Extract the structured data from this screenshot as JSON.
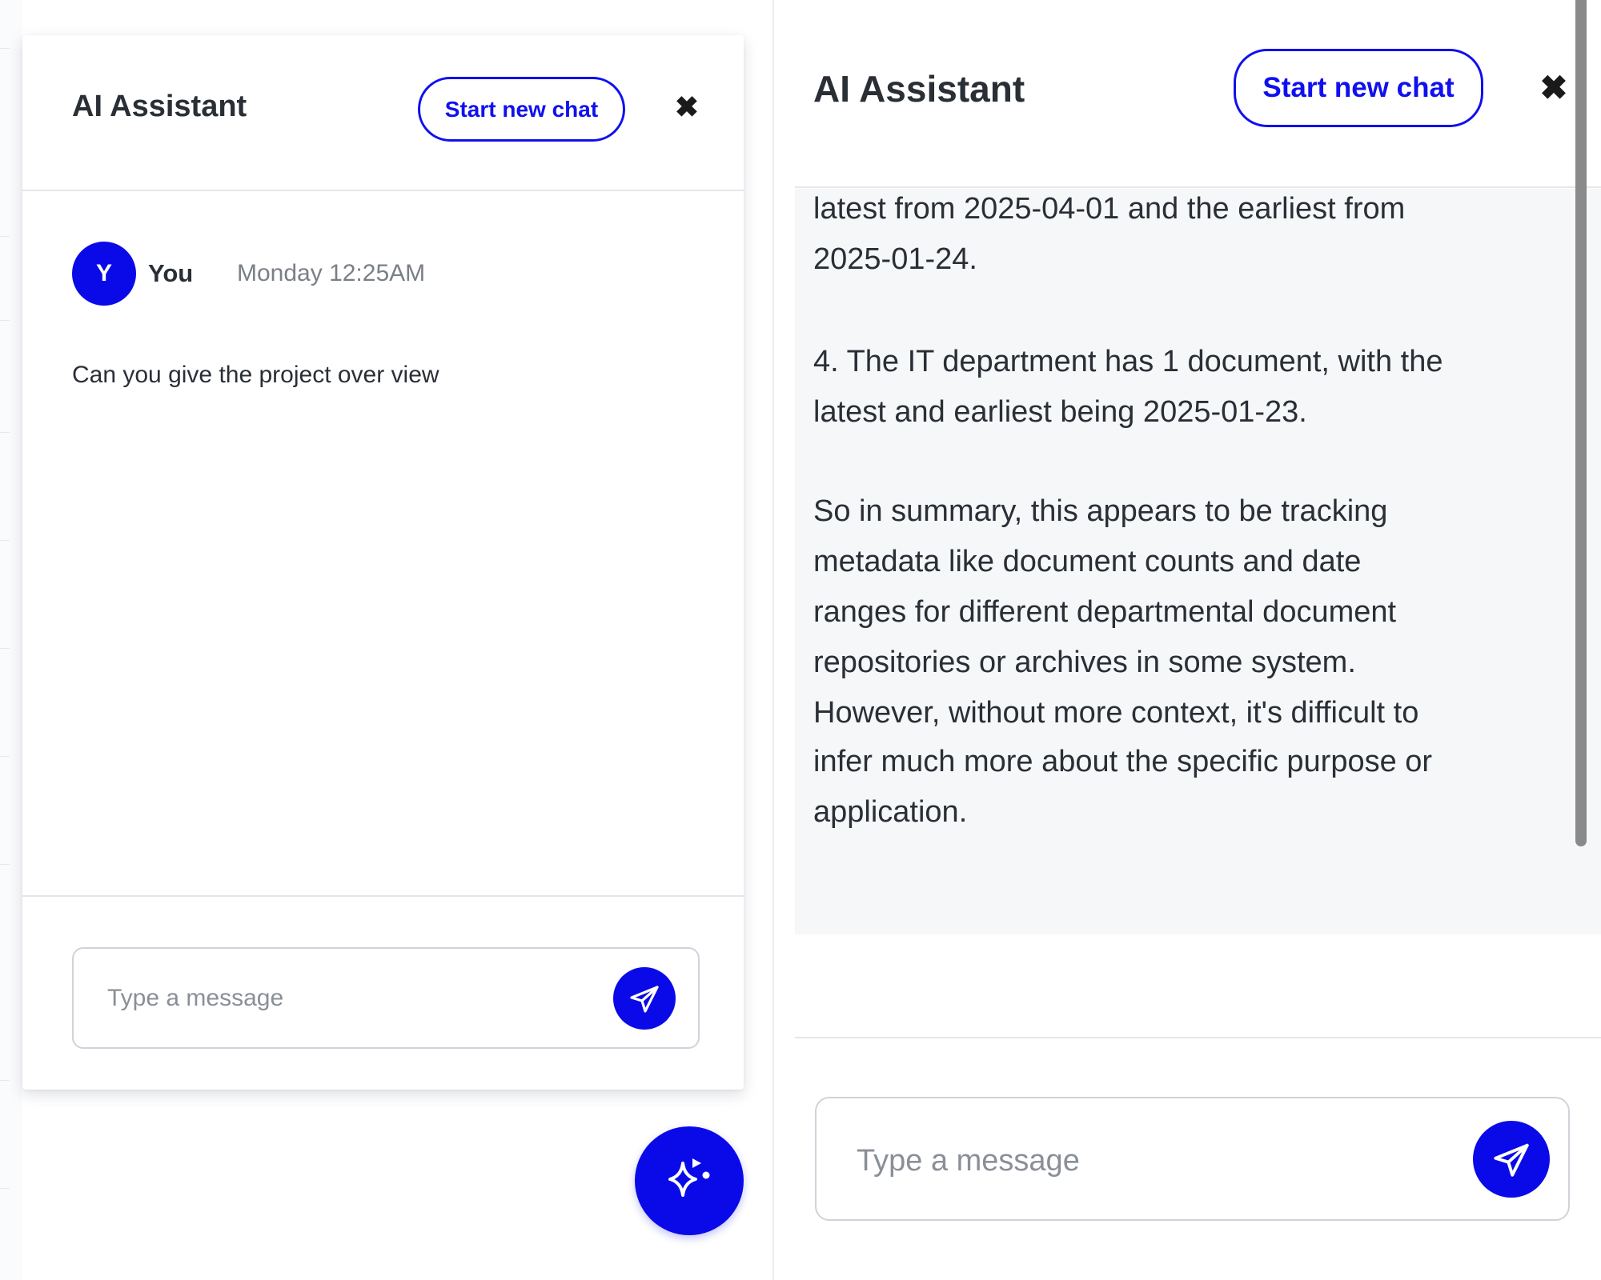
{
  "left_panel": {
    "title": "AI Assistant",
    "new_chat_label": "Start new chat",
    "close_symbol": "✖",
    "message": {
      "avatar_initial": "Y",
      "sender": "You",
      "timestamp": "Monday 12:25AM",
      "text": "Can you give the project over view"
    },
    "input_placeholder": "Type a message",
    "send_icon": "paper-plane-icon"
  },
  "fab": {
    "icon": "sparkle-icon"
  },
  "right_panel": {
    "title": "AI Assistant",
    "new_chat_label": "Start new chat",
    "close_symbol": "✖",
    "response_lines": [
      "latest from 2025-04-01 and the earliest from",
      "2025-01-24.",
      "4. The IT department has 1 document, with the",
      "latest and earliest being 2025-01-23.",
      "So in summary, this appears to be tracking",
      "metadata like document counts and date",
      "ranges for different departmental document",
      "repositories or archives in some system.",
      "However, without more context, it's difficult to",
      "infer much more about the specific purpose or",
      "application."
    ],
    "input_placeholder": "Type a message",
    "send_icon": "paper-plane-icon"
  },
  "colors": {
    "accent": "#0a0ae8",
    "border": "#cfd3da",
    "panel_bg_alt": "#f6f7f9",
    "text": "#2a2f36",
    "muted": "#7a7f87"
  }
}
